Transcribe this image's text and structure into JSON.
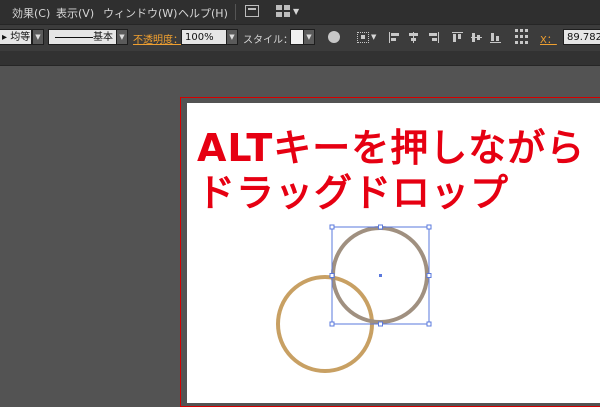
{
  "menubar": {
    "items": [
      {
        "label": "効果(C)"
      },
      {
        "label": "表示(V)"
      },
      {
        "label": "ウィンドウ(W)"
      },
      {
        "label": "ヘルプ(H)"
      }
    ]
  },
  "toolbar": {
    "profile_value": "均等",
    "brush_value": "基本",
    "opacity_label": "不透明度：",
    "opacity_value": "100%",
    "style_label": "スタイル：",
    "x_label": "X：",
    "x_value": "89.782"
  },
  "canvas": {
    "caption_line1": "ALTキーを押しながら",
    "caption_line2": "ドラッグドロップ"
  },
  "colors": {
    "circle_stroke": "#c8a063",
    "selected_circle_stroke": "#a09080",
    "selection_box": "#5a78dc",
    "caption": "#e60012",
    "artboard_border": "#d40000"
  }
}
